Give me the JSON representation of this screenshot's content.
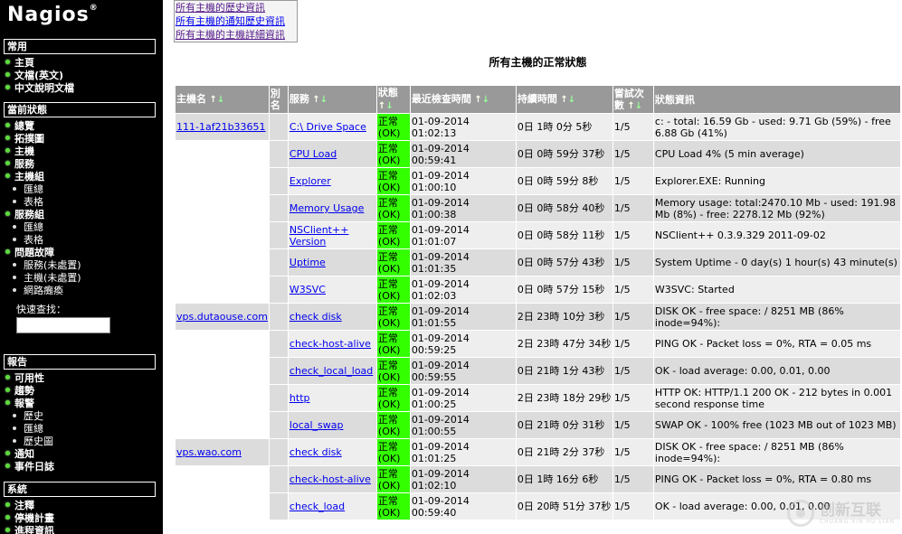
{
  "sidebar": {
    "logo": "Nagios",
    "sections": [
      {
        "title": "常用",
        "items": [
          {
            "label": "主頁",
            "level": 1
          },
          {
            "label": "文檔(英文)",
            "level": 1
          },
          {
            "label": "中文說明文檔",
            "level": 1
          }
        ]
      },
      {
        "title": "當前狀態",
        "items": [
          {
            "label": "總覽",
            "level": 1
          },
          {
            "label": "拓撲圖",
            "level": 1
          },
          {
            "label": "主機",
            "level": 1
          },
          {
            "label": "服務",
            "level": 1
          },
          {
            "label": "主機組",
            "level": 1
          },
          {
            "label": "匯總",
            "level": 2
          },
          {
            "label": "表格",
            "level": 2
          },
          {
            "label": "服務組",
            "level": 1
          },
          {
            "label": "匯總",
            "level": 2
          },
          {
            "label": "表格",
            "level": 2
          },
          {
            "label": "問題故障",
            "level": 1
          },
          {
            "label": "服務(未處置)",
            "level": 2
          },
          {
            "label": "主機(未處置)",
            "level": 2
          },
          {
            "label": "網路癱瘓",
            "level": 2
          }
        ]
      },
      {
        "title": "報告",
        "items": [
          {
            "label": "可用性",
            "level": 1
          },
          {
            "label": "趨勢",
            "level": 1
          },
          {
            "label": "報警",
            "level": 1
          },
          {
            "label": "歷史",
            "level": 2
          },
          {
            "label": "匯總",
            "level": 2
          },
          {
            "label": "歷史圖",
            "level": 2
          },
          {
            "label": "通知",
            "level": 1
          },
          {
            "label": "事件日誌",
            "level": 1
          }
        ]
      },
      {
        "title": "系統",
        "items": [
          {
            "label": "注釋",
            "level": 1
          },
          {
            "label": "停機計畫",
            "level": 1
          },
          {
            "label": "進程資訊",
            "level": 1
          }
        ]
      }
    ],
    "quick_search_label": "快速查找："
  },
  "top_links": [
    "所有主機的歷史資訊",
    "所有主機的通知歷史資訊",
    "所有主機的主機詳細資訊"
  ],
  "page_title": "所有主機的正常狀態",
  "table": {
    "headers": [
      "主機名",
      "別名",
      "服務",
      "狀態",
      "最近檢查時間",
      "持續時間",
      "嘗試次數",
      "狀態資訊"
    ],
    "sortable": [
      true,
      false,
      true,
      true,
      true,
      true,
      true,
      false
    ],
    "status_label": "正常",
    "status_sub": "(OK)",
    "rows": [
      {
        "host": "111-1af21b33651",
        "service": "C:\\ Drive Space",
        "last_check": "01-09-2014 01:02:13",
        "duration": "0日 1時 0分 5秒",
        "attempt": "1/5",
        "info": "c: - total: 16.59 Gb - used: 9.71 Gb (59%) - free 6.88 Gb (41%)"
      },
      {
        "host": "",
        "service": "CPU Load",
        "last_check": "01-09-2014 00:59:41",
        "duration": "0日 0時 59分 37秒",
        "attempt": "1/5",
        "info": "CPU Load 4% (5 min average)"
      },
      {
        "host": "",
        "service": "Explorer",
        "last_check": "01-09-2014 01:00:10",
        "duration": "0日 0時 59分 8秒",
        "attempt": "1/5",
        "info": "Explorer.EXE: Running"
      },
      {
        "host": "",
        "service": "Memory Usage",
        "last_check": "01-09-2014 01:00:38",
        "duration": "0日 0時 58分 40秒",
        "attempt": "1/5",
        "info": "Memory usage: total:2470.10 Mb - used: 191.98 Mb (8%) - free: 2278.12 Mb (92%)"
      },
      {
        "host": "",
        "service": "NSClient++ Version",
        "last_check": "01-09-2014 01:01:07",
        "duration": "0日 0時 58分 11秒",
        "attempt": "1/5",
        "info": "NSClient++ 0.3.9.329 2011-09-02"
      },
      {
        "host": "",
        "service": "Uptime",
        "last_check": "01-09-2014 01:01:35",
        "duration": "0日 0時 57分 43秒",
        "attempt": "1/5",
        "info": "System Uptime - 0 day(s) 1 hour(s) 43 minute(s)"
      },
      {
        "host": "",
        "service": "W3SVC",
        "last_check": "01-09-2014 01:02:03",
        "duration": "0日 0時 57分 15秒",
        "attempt": "1/5",
        "info": "W3SVC: Started"
      },
      {
        "host": "vps.dutaouse.com",
        "service": "check disk",
        "last_check": "01-09-2014 01:01:55",
        "duration": "2日 23時 10分 3秒",
        "attempt": "1/5",
        "info": "DISK OK - free space: / 8251 MB (86% inode=94%):"
      },
      {
        "host": "",
        "service": "check-host-alive",
        "last_check": "01-09-2014 00:59:25",
        "duration": "2日 23時 47分 34秒",
        "attempt": "1/5",
        "info": "PING OK - Packet loss = 0%, RTA = 0.05 ms"
      },
      {
        "host": "",
        "service": "check_local_load",
        "last_check": "01-09-2014 00:59:55",
        "duration": "0日 21時 1分 43秒",
        "attempt": "1/5",
        "info": "OK - load average: 0.00, 0.01, 0.00"
      },
      {
        "host": "",
        "service": "http",
        "last_check": "01-09-2014 01:00:25",
        "duration": "2日 23時 18分 29秒",
        "attempt": "1/5",
        "info": "HTTP OK: HTTP/1.1 200 OK - 212 bytes in 0.001 second response time"
      },
      {
        "host": "",
        "service": "local_swap",
        "last_check": "01-09-2014 01:00:55",
        "duration": "0日 21時 0分 31秒",
        "attempt": "1/5",
        "info": "SWAP OK - 100% free (1023 MB out of 1023 MB)"
      },
      {
        "host": "vps.wao.com",
        "service": "check disk",
        "last_check": "01-09-2014 01:01:25",
        "duration": "0日 21時 2分 37秒",
        "attempt": "1/5",
        "info": "DISK OK - free space: / 8251 MB (86% inode=94%):"
      },
      {
        "host": "",
        "service": "check-host-alive",
        "last_check": "01-09-2014 01:02:10",
        "duration": "0日 1時 16分 6秒",
        "attempt": "1/5",
        "info": "PING OK - Packet loss = 0%, RTA = 0.80 ms"
      },
      {
        "host": "",
        "service": "check_load",
        "last_check": "01-09-2014 00:59:40",
        "duration": "0日 20時 51分 37秒",
        "attempt": "1/5",
        "info": "OK - load average: 0.00, 0.01, 0.00"
      }
    ]
  },
  "colors": {
    "status_ok": "#33ff00",
    "header_bg": "#999999",
    "row_even": "#eeeeee",
    "row_odd": "#dcdcdc",
    "sidebar_bg": "#000000"
  },
  "watermark": {
    "text": "创新互联",
    "sub": "CHUANG XIN HU LIAN"
  }
}
